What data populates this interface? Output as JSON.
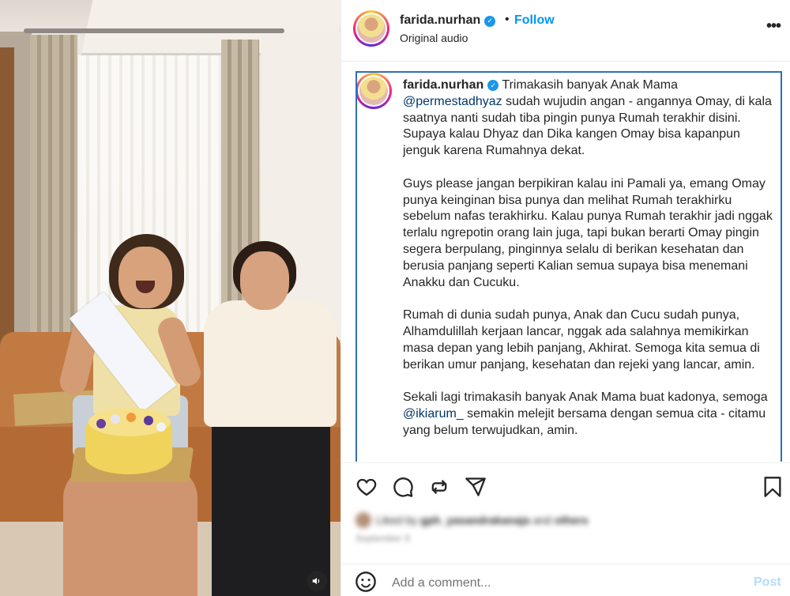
{
  "media": {
    "volume_icon": "speaker-icon"
  },
  "header": {
    "username": "farida.nurhan",
    "separator": "•",
    "follow_label": "Follow",
    "audio_label": "Original audio",
    "more_label": "•••"
  },
  "caption": {
    "username": "farida.nurhan",
    "p1_text_a": "Trimakasih banyak Anak Mama",
    "p1_mention": "@permestadhyaz",
    "p1_text_b": "sudah wujudin angan - angannya Omay, di kala saatnya nanti sudah tiba pingin punya Rumah terakhir disini. Supaya kalau Dhyaz dan Dika kangen Omay bisa kapanpun jenguk karena Rumahnya dekat.",
    "p2": "Guys please jangan berpikiran kalau ini Pamali ya, emang Omay punya keinginan bisa punya dan melihat Rumah terakhirku sebelum nafas terakhirku. Kalau punya Rumah terakhir jadi nggak terlalu ngrepotin orang lain juga, tapi bukan berarti Omay pingin segera berpulang, pinginnya selalu di berikan kesehatan dan berusia panjang seperti Kalian semua supaya bisa menemani Anakku dan Cucuku.",
    "p3": "Rumah di dunia sudah punya, Anak dan Cucu sudah punya, Alhamdulillah kerjaan lancar, nggak ada salahnya memikirkan masa depan yang lebih panjang, Akhirat. Semoga kita semua di berikan umur panjang, kesehatan dan rejeki yang lancar, amin.",
    "p4_text_a": "Sekali lagi trimakasih banyak Anak Mama buat kadonya, semoga",
    "p4_mention": "@ikiarum_",
    "p4_text_b": "semakin melejit bersama dengan semua cita - citamu yang belum terwujudkan, amin."
  },
  "actions": {
    "like_icon": "heart-icon",
    "comment_icon": "comment-icon",
    "share_icon": "repost-icon",
    "send_icon": "send-icon",
    "save_icon": "bookmark-icon"
  },
  "likes": {
    "text_a": "Liked by",
    "text_user": "gph_yasandrakanaja",
    "text_b": "and",
    "text_others": "others"
  },
  "date": "September 9",
  "comment": {
    "placeholder": "Add a comment...",
    "post_label": "Post"
  },
  "colors": {
    "follow": "#0095f6",
    "mention": "#00376b",
    "post_disabled": "#b3dbff",
    "verified": "#1c96e8",
    "highlight_border": "#2f6fb8"
  }
}
